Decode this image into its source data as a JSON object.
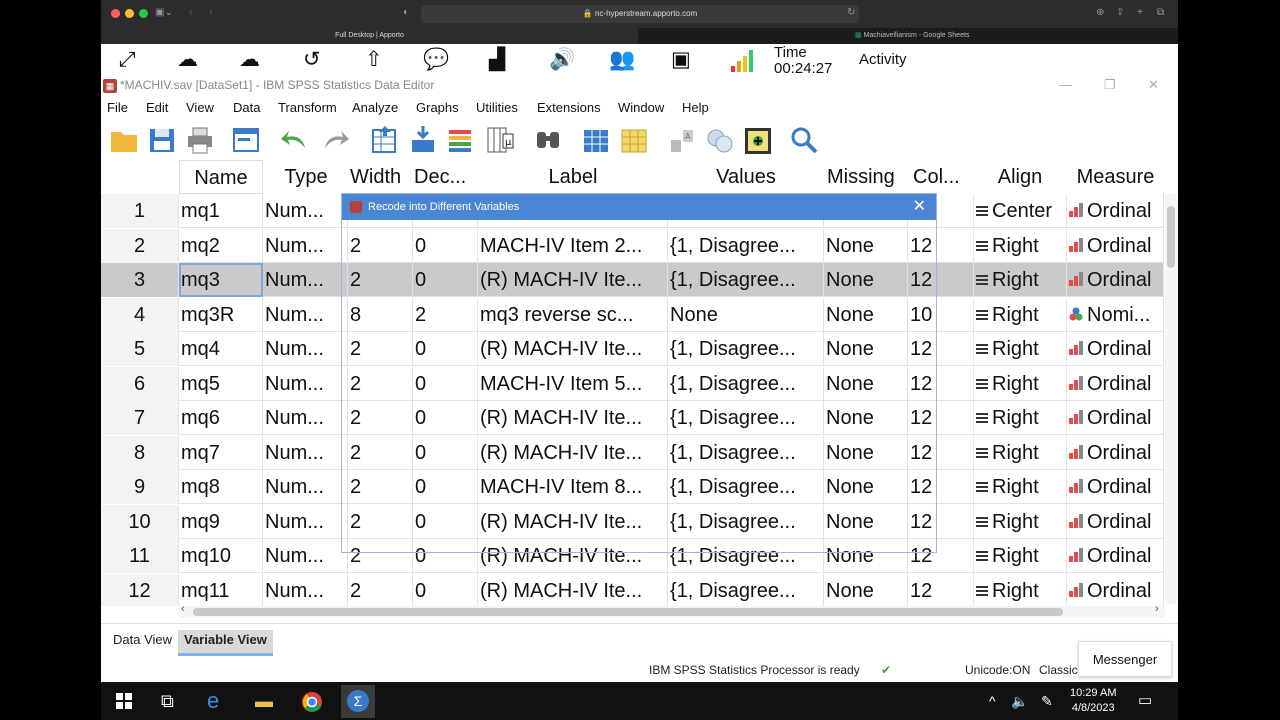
{
  "browser": {
    "url": "nc-hyperstream.apporto.com",
    "active_tab": "Full Desktop | Apporto",
    "inactive_tab": "Machiavellianism - Google Sheets"
  },
  "apporto": {
    "time_label": "Time",
    "time_value": "00:24:27",
    "activity_label": "Activity"
  },
  "window": {
    "title": "*MACHIV.sav [DataSet1] - IBM SPSS Statistics Data Editor"
  },
  "menu": [
    "File",
    "Edit",
    "View",
    "Data",
    "Transform",
    "Analyze",
    "Graphs",
    "Utilities",
    "Extensions",
    "Window",
    "Help"
  ],
  "grid": {
    "headers": [
      "Name",
      "Type",
      "Width",
      "Dec...",
      "Label",
      "Values",
      "Missing",
      "Col...",
      "Align",
      "Measure"
    ],
    "rows": [
      {
        "num": "1",
        "name": "mq1",
        "type": "Num...",
        "width": "",
        "dec": "",
        "label": "",
        "values": "",
        "missing": "",
        "col": "",
        "align": "Center",
        "measure": "Ordinal"
      },
      {
        "num": "2",
        "name": "mq2",
        "type": "Num...",
        "width": "2",
        "dec": "0",
        "label": "MACH-IV Item 2...",
        "values": "{1, Disagree...",
        "missing": "None",
        "col": "12",
        "align": "Right",
        "measure": "Ordinal"
      },
      {
        "num": "3",
        "name": "mq3",
        "type": "Num...",
        "width": "2",
        "dec": "0",
        "label": "(R) MACH-IV Ite...",
        "values": "{1, Disagree...",
        "missing": "None",
        "col": "12",
        "align": "Right",
        "measure": "Ordinal"
      },
      {
        "num": "4",
        "name": "mq3R",
        "type": "Num...",
        "width": "8",
        "dec": "2",
        "label": "mq3 reverse sc...",
        "values": "None",
        "missing": "None",
        "col": "10",
        "align": "Right",
        "measure": "Nomi..."
      },
      {
        "num": "5",
        "name": "mq4",
        "type": "Num...",
        "width": "2",
        "dec": "0",
        "label": "(R) MACH-IV Ite...",
        "values": "{1, Disagree...",
        "missing": "None",
        "col": "12",
        "align": "Right",
        "measure": "Ordinal"
      },
      {
        "num": "6",
        "name": "mq5",
        "type": "Num...",
        "width": "2",
        "dec": "0",
        "label": "MACH-IV Item 5...",
        "values": "{1, Disagree...",
        "missing": "None",
        "col": "12",
        "align": "Right",
        "measure": "Ordinal"
      },
      {
        "num": "7",
        "name": "mq6",
        "type": "Num...",
        "width": "2",
        "dec": "0",
        "label": "(R) MACH-IV Ite...",
        "values": "{1, Disagree...",
        "missing": "None",
        "col": "12",
        "align": "Right",
        "measure": "Ordinal"
      },
      {
        "num": "8",
        "name": "mq7",
        "type": "Num...",
        "width": "2",
        "dec": "0",
        "label": "(R) MACH-IV Ite...",
        "values": "{1, Disagree...",
        "missing": "None",
        "col": "12",
        "align": "Right",
        "measure": "Ordinal"
      },
      {
        "num": "9",
        "name": "mq8",
        "type": "Num...",
        "width": "2",
        "dec": "0",
        "label": "MACH-IV Item 8...",
        "values": "{1, Disagree...",
        "missing": "None",
        "col": "12",
        "align": "Right",
        "measure": "Ordinal"
      },
      {
        "num": "10",
        "name": "mq9",
        "type": "Num...",
        "width": "2",
        "dec": "0",
        "label": "(R) MACH-IV Ite...",
        "values": "{1, Disagree...",
        "missing": "None",
        "col": "12",
        "align": "Right",
        "measure": "Ordinal"
      },
      {
        "num": "11",
        "name": "mq10",
        "type": "Num...",
        "width": "2",
        "dec": "0",
        "label": "(R) MACH-IV Ite...",
        "values": "{1, Disagree...",
        "missing": "None",
        "col": "12",
        "align": "Right",
        "measure": "Ordinal"
      },
      {
        "num": "12",
        "name": "mq11",
        "type": "Num...",
        "width": "2",
        "dec": "0",
        "label": "(R) MACH-IV Ite...",
        "values": "{1, Disagree...",
        "missing": "None",
        "col": "12",
        "align": "Right",
        "measure": "Ordinal"
      }
    ]
  },
  "dialog": {
    "title": "Recode into Different Variables"
  },
  "view_tabs": {
    "data_view": "Data View",
    "variable_view": "Variable View"
  },
  "status": {
    "processor": "IBM SPSS Statistics Processor is ready",
    "unicode": "Unicode:ON",
    "classic": "Classic"
  },
  "messenger": "Messenger",
  "taskbar": {
    "time": "10:29 AM",
    "date": "4/8/2023"
  }
}
